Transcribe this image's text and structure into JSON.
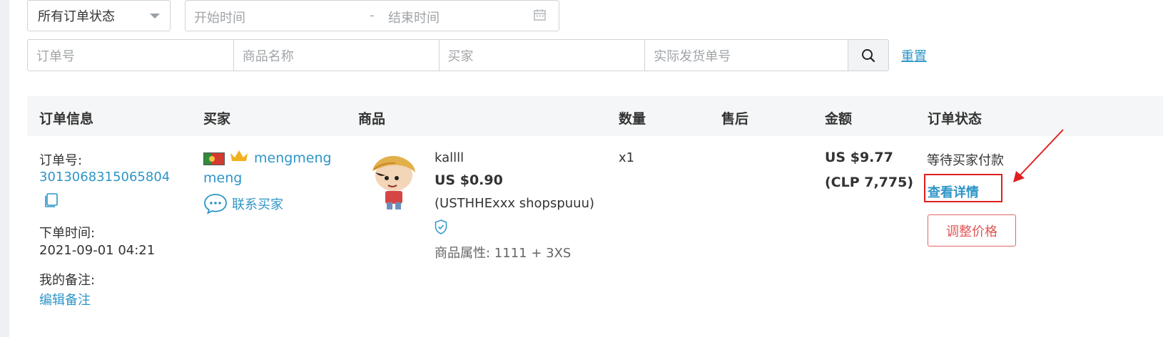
{
  "filters": {
    "status_value": "所有订单状态",
    "start_placeholder": "开始时间",
    "date_sep": "-",
    "end_placeholder": "结束时间",
    "order_no_placeholder": "订单号",
    "product_name_placeholder": "商品名称",
    "buyer_placeholder": "买家",
    "tracking_no_placeholder": "实际发货单号",
    "reset_label": "重置"
  },
  "table": {
    "headers": [
      "订单信息",
      "买家",
      "商品",
      "数量",
      "售后",
      "金额",
      "订单状态"
    ]
  },
  "order": {
    "order_no_label": "订单号:",
    "order_no": "3013068315065804",
    "time_label": "下单时间:",
    "time": "2021-09-01 04:21",
    "note_label": "我的备注:",
    "edit_note": "编辑备注",
    "buyer_name_1": "mengmeng",
    "buyer_name_2": "meng",
    "contact_buyer": "联系买家",
    "product_title": "kallll",
    "product_price": "US $0.90",
    "product_sku": "(USTHHExxx shopspuuu)",
    "product_attr": "商品属性: 1111 + 3XS",
    "quantity": "x1",
    "amount_usd": "US $9.77",
    "amount_local": "(CLP 7,775)",
    "status": "等待买家付款",
    "view_detail": "查看详情",
    "adjust_price": "调整价格"
  },
  "colors": {
    "link": "#2e95c7",
    "highlight_box": "#e02020",
    "adjust_border": "#e06666"
  },
  "icons": [
    "chevron-down-icon",
    "calendar-icon",
    "search-icon",
    "copy-icon",
    "flag-icon",
    "crown-icon",
    "chat-icon",
    "shield-check-icon",
    "arrow-annotation-icon"
  ]
}
